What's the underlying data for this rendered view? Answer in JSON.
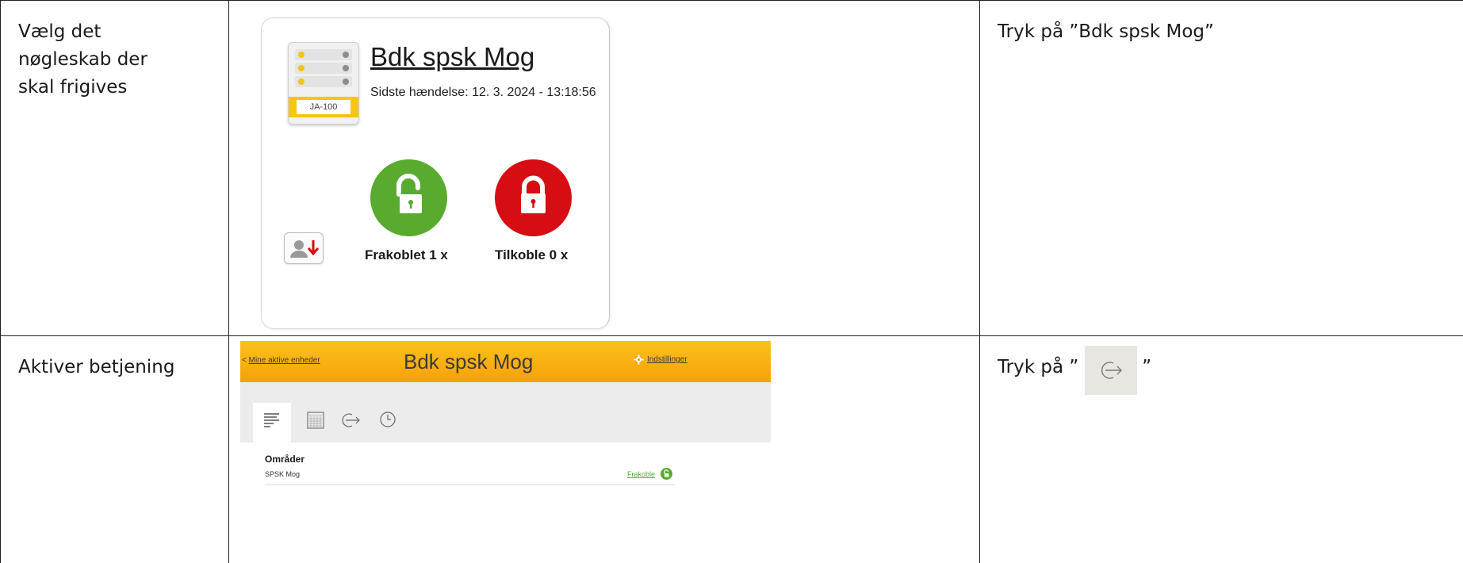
{
  "rows": [
    {
      "step": "Vælg det nøgleskab der skal frigives",
      "instruction_prefix": "Tryk på ”Bdk spsk Mog”",
      "device_card": {
        "title": "Bdk spsk Mog",
        "last_event": "Sidste hændelse: 12. 3. 2024 - 13:18:56",
        "device_label": "JA-100",
        "unlocked_label": "Frakoblet 1 x",
        "locked_label": "Tilkoble 0 x",
        "icon_names": [
          "keybox-device-icon",
          "unlock-icon",
          "lock-icon",
          "user-download-icon"
        ]
      }
    },
    {
      "step": "Aktiver betjening",
      "instruction_prefix": "Tryk på ”",
      "instruction_suffix": "”",
      "instruction_icon": "arrow-right-circle-icon",
      "app_view": {
        "back_arrow": "<",
        "back_link": "Mine aktive enheder",
        "title": "Bdk spsk Mog",
        "settings_link": "Indstillinger",
        "tabs": [
          "list-icon",
          "calendar-icon",
          "arrow-right-circle-icon",
          "clock-icon"
        ],
        "section_title": "Områder",
        "area_name": "SPSK Mog",
        "area_action": "Frakoble"
      }
    }
  ],
  "colors": {
    "accent_yellow": "#f7c514",
    "header_orange": "#f6a10a",
    "unlock_green": "#59ab2f",
    "lock_red": "#d60d13"
  }
}
